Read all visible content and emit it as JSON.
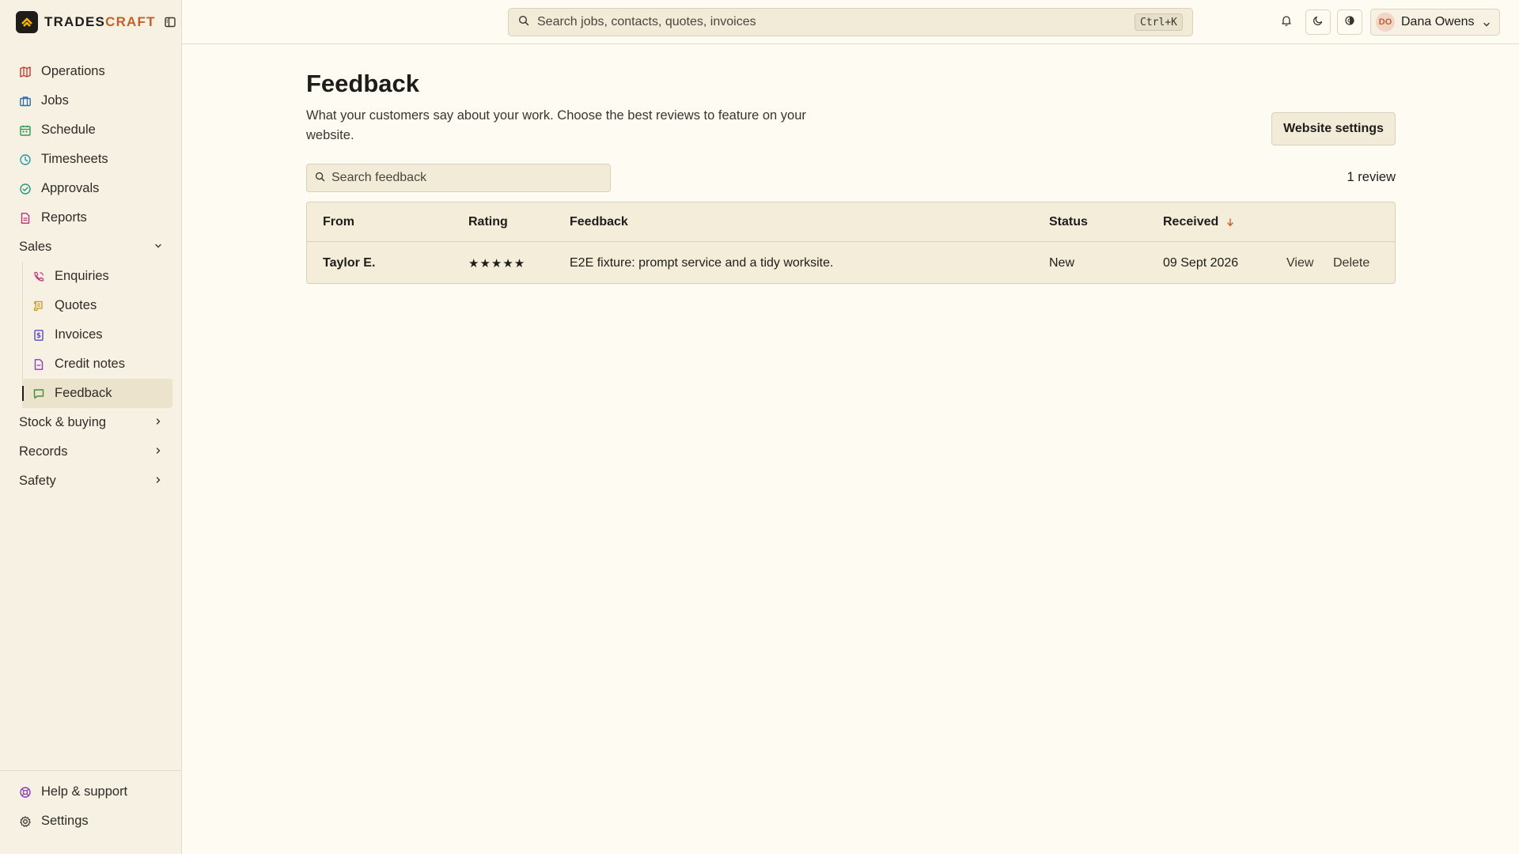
{
  "brand": {
    "name_part1": "TRADES",
    "name_part2": "CRAFT"
  },
  "sidebar": {
    "items": [
      {
        "label": "Operations",
        "icon": "map-icon",
        "color": "#c0392b"
      },
      {
        "label": "Jobs",
        "icon": "briefcase-icon",
        "color": "#2d6bb5"
      },
      {
        "label": "Schedule",
        "icon": "calendar-icon",
        "color": "#2e9a55"
      },
      {
        "label": "Timesheets",
        "icon": "clock-icon",
        "color": "#1f9aa6"
      },
      {
        "label": "Approvals",
        "icon": "check-circle-icon",
        "color": "#1f9a7a"
      },
      {
        "label": "Reports",
        "icon": "file-icon",
        "color": "#b8327a"
      }
    ],
    "sales_group": {
      "label": "Sales",
      "items": [
        {
          "label": "Enquiries",
          "icon": "phone-icon",
          "color": "#c2417f"
        },
        {
          "label": "Quotes",
          "icon": "scroll-icon",
          "color": "#c49a1a"
        },
        {
          "label": "Invoices",
          "icon": "invoice-icon",
          "color": "#5b4ac9"
        },
        {
          "label": "Credit notes",
          "icon": "document-icon",
          "color": "#8a3fb5"
        },
        {
          "label": "Feedback",
          "icon": "message-icon",
          "color": "#4a8a3a"
        }
      ]
    },
    "groups": [
      {
        "label": "Stock & buying"
      },
      {
        "label": "Records"
      },
      {
        "label": "Safety"
      }
    ],
    "footer": [
      {
        "label": "Help & support",
        "icon": "lifebuoy-icon",
        "color": "#8a3fb5"
      },
      {
        "label": "Settings",
        "icon": "gear-icon",
        "color": "#3a362f"
      }
    ]
  },
  "topbar": {
    "search_placeholder": "Search jobs, contacts, quotes, invoices",
    "shortcut": "Ctrl+K",
    "user": {
      "initials": "DO",
      "name": "Dana Owens"
    }
  },
  "page": {
    "title": "Feedback",
    "description": "What your customers say about your work. Choose the best reviews to feature on your website.",
    "settings_button": "Website settings",
    "search_placeholder": "Search feedback",
    "review_count": "1 review"
  },
  "table": {
    "columns": {
      "from": "From",
      "rating": "Rating",
      "feedback": "Feedback",
      "status": "Status",
      "received": "Received"
    },
    "rows": [
      {
        "from": "Taylor E.",
        "rating": 5,
        "stars": "★★★★★",
        "feedback": "E2E fixture: prompt service and a tidy worksite.",
        "status": "New",
        "received": "09 Sept 2026",
        "view": "View",
        "delete": "Delete"
      }
    ]
  },
  "colors": {
    "accent": "#c0622b",
    "background": "#fefbf3",
    "sidebar": "#f6f1e2"
  }
}
